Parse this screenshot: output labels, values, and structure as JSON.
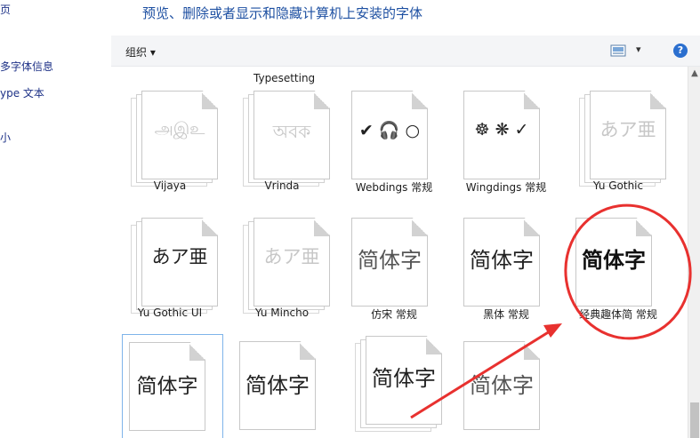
{
  "header": {
    "title": "预览、删除或者显示和隐藏计算机上安装的字体"
  },
  "left_panel": {
    "items": [
      "页",
      "多字体信息",
      "ype 文本",
      "小"
    ]
  },
  "toolbar": {
    "organize_label": "组织 ▾",
    "view_label": "▾",
    "help_label": "?"
  },
  "partial_caption": "Typesetting",
  "fonts": [
    {
      "name": "Vijaya",
      "sample": "அஇஉ"
    },
    {
      "name": "Vrinda",
      "sample": "অবক"
    },
    {
      "name": "Webdings 常规",
      "sample": "✔ 🎧 ○"
    },
    {
      "name": "Wingdings 常规",
      "sample": "☸ ❋ ✓"
    },
    {
      "name": "Yu Gothic",
      "sample": "あア亜"
    },
    {
      "name": "Yu Gothic UI",
      "sample": "あア亜"
    },
    {
      "name": "Yu Mincho",
      "sample": "あア亜"
    },
    {
      "name": "仿宋 常规",
      "sample": "简体字"
    },
    {
      "name": "黑体 常规",
      "sample": "简体字"
    },
    {
      "name": "经典趣体简 常规",
      "sample": "简体字"
    },
    {
      "name": "",
      "sample": "简体字"
    },
    {
      "name": "",
      "sample": "简体字"
    },
    {
      "name": "",
      "sample": "简体字"
    },
    {
      "name": "",
      "sample": "简体字"
    }
  ],
  "annotation": {
    "color": "#e8312f"
  }
}
